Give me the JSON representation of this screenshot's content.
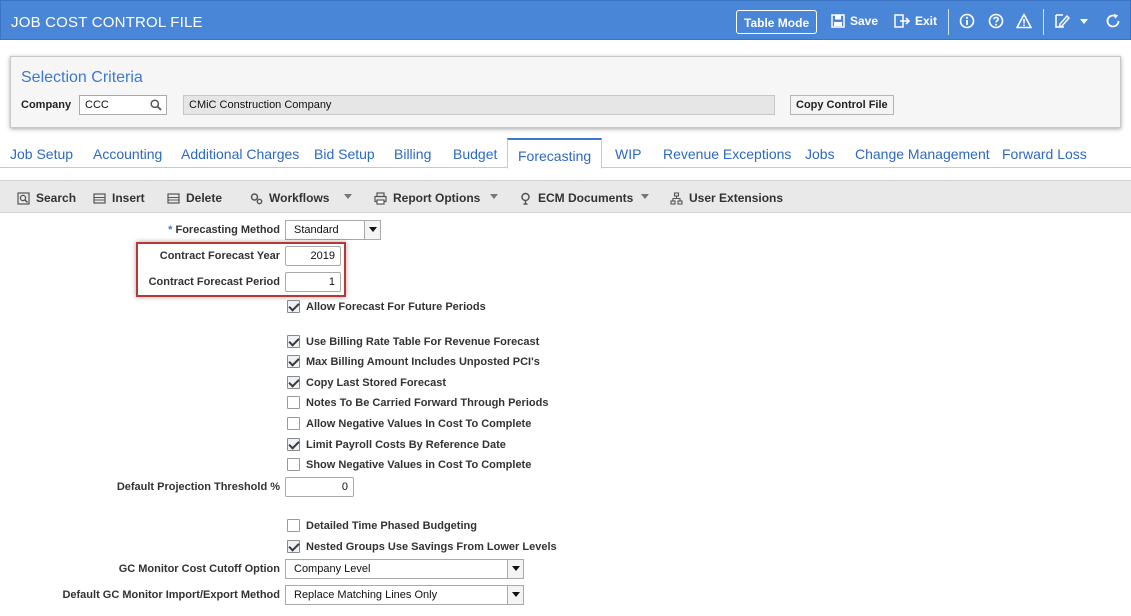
{
  "header": {
    "title": "JOB COST CONTROL FILE",
    "table_mode": "Table Mode",
    "save": "Save",
    "exit": "Exit"
  },
  "selection": {
    "title": "Selection Criteria",
    "company_label": "Company",
    "company_value": "CCC",
    "company_name": "CMiC Construction Company",
    "copy_button": "Copy Control File"
  },
  "tabs": [
    {
      "label": "Job Setup"
    },
    {
      "label": "Accounting"
    },
    {
      "label": "Additional Charges"
    },
    {
      "label": "Bid Setup"
    },
    {
      "label": "Billing"
    },
    {
      "label": "Budget"
    },
    {
      "label": "Forecasting",
      "active": true
    },
    {
      "label": "WIP"
    },
    {
      "label": "Revenue Exceptions"
    },
    {
      "label": "Jobs"
    },
    {
      "label": "Change Management"
    },
    {
      "label": "Forward Loss"
    }
  ],
  "toolbar": {
    "search": "Search",
    "insert": "Insert",
    "delete": "Delete",
    "workflows": "Workflows",
    "report_options": "Report Options",
    "ecm_documents": "ECM Documents",
    "user_extensions": "User Extensions"
  },
  "form": {
    "forecasting_method_label": "Forecasting Method",
    "forecasting_method_value": "Standard",
    "contract_year_label": "Contract Forecast Year",
    "contract_year_value": "2019",
    "contract_period_label": "Contract Forecast Period",
    "contract_period_value": "1",
    "checks1": [
      {
        "label": "Allow Forecast For Future Periods",
        "checked": true
      }
    ],
    "checks2": [
      {
        "label": "Use Billing Rate Table For Revenue Forecast",
        "checked": true
      },
      {
        "label": "Max Billing Amount Includes Unposted PCI's",
        "checked": true
      },
      {
        "label": "Copy Last Stored Forecast",
        "checked": true
      },
      {
        "label": "Notes To Be Carried Forward Through Periods",
        "checked": false
      },
      {
        "label": "Allow Negative Values In Cost To Complete",
        "checked": false
      },
      {
        "label": "Limit Payroll Costs By Reference Date",
        "checked": true
      },
      {
        "label": "Show Negative Values in Cost To Complete",
        "checked": false
      }
    ],
    "threshold_label": "Default Projection Threshold %",
    "threshold_value": "0",
    "checks3": [
      {
        "label": "Detailed Time Phased Budgeting",
        "checked": false
      },
      {
        "label": "Nested Groups Use Savings From Lower Levels",
        "checked": true
      }
    ],
    "gc_cutoff_label": "GC Monitor Cost Cutoff Option",
    "gc_cutoff_value": "Company Level",
    "gc_import_label": "Default GC Monitor Import/Export Method",
    "gc_import_value": "Replace Matching Lines Only"
  }
}
